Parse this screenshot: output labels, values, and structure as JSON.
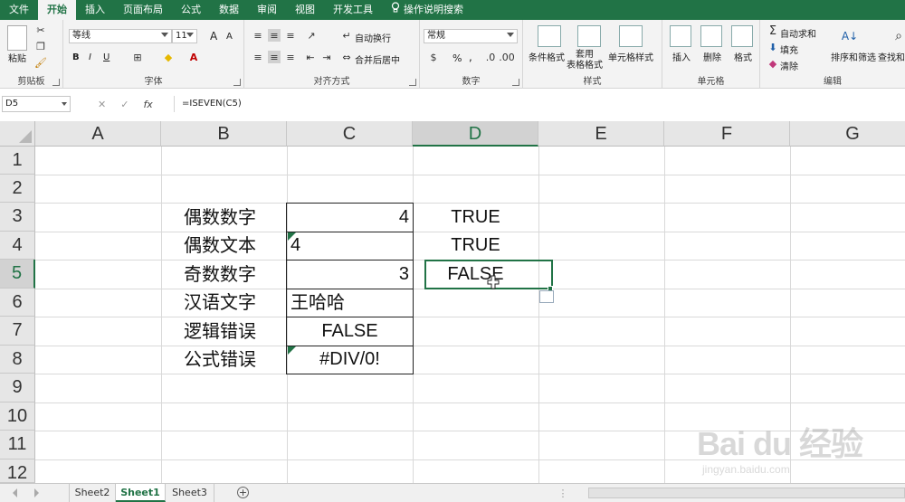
{
  "menu_tabs": [
    "文件",
    "开始",
    "插入",
    "页面布局",
    "公式",
    "数据",
    "审阅",
    "视图",
    "开发工具",
    "操作说明搜索"
  ],
  "ribbon": {
    "clipboard": {
      "paste": "粘贴",
      "label": "剪贴板"
    },
    "font": {
      "name": "等线",
      "size": "11",
      "label": "字体",
      "bold": "B",
      "italic": "I",
      "underline": "U",
      "grow": "A",
      "shrink": "A"
    },
    "alignment": {
      "wrap": "自动换行",
      "merge": "合并后居中",
      "label": "对齐方式"
    },
    "number": {
      "format": "常规",
      "percent": "%",
      "comma": ",",
      "label": "数字"
    },
    "styles": {
      "conditional": "条件格式",
      "table": "套用\n表格格式",
      "cell_styles": "单元格样式",
      "label": "样式"
    },
    "cells": {
      "insert": "插入",
      "delete": "删除",
      "format": "格式",
      "label": "单元格"
    },
    "editing": {
      "autosum": "自动求和",
      "fill": "填充",
      "clear": "清除",
      "sort": "排序和筛选",
      "find": "查找和",
      "label": "编辑"
    }
  },
  "formula_bar": {
    "name_box": "D5",
    "cancel": "✕",
    "enter": "✓",
    "fx": "fx",
    "formula": "=ISEVEN(C5)"
  },
  "columns": [
    "A",
    "B",
    "C",
    "D",
    "E",
    "F",
    "G"
  ],
  "rows": [
    "1",
    "2",
    "3",
    "4",
    "5",
    "6",
    "7",
    "8",
    "9",
    "10",
    "11",
    "12"
  ],
  "cells": {
    "B3": "偶数数字",
    "B4": "偶数文本",
    "B5": "奇数数字",
    "B6": "汉语文字",
    "B7": "逻辑错误",
    "B8": "公式错误",
    "C3": "4",
    "C4": "4",
    "C5": "3",
    "C6": "王哈哈",
    "C7": "FALSE",
    "C8": "#DIV/0!",
    "D3": "TRUE",
    "D4": "TRUE",
    "D5": "FALSE"
  },
  "selected_cell": "D5",
  "sheets": [
    "Sheet2",
    "Sheet1",
    "Sheet3"
  ],
  "active_sheet": "Sheet1",
  "watermark": {
    "brand": "Bai du 经验",
    "url": "jingyan.baidu.com"
  }
}
